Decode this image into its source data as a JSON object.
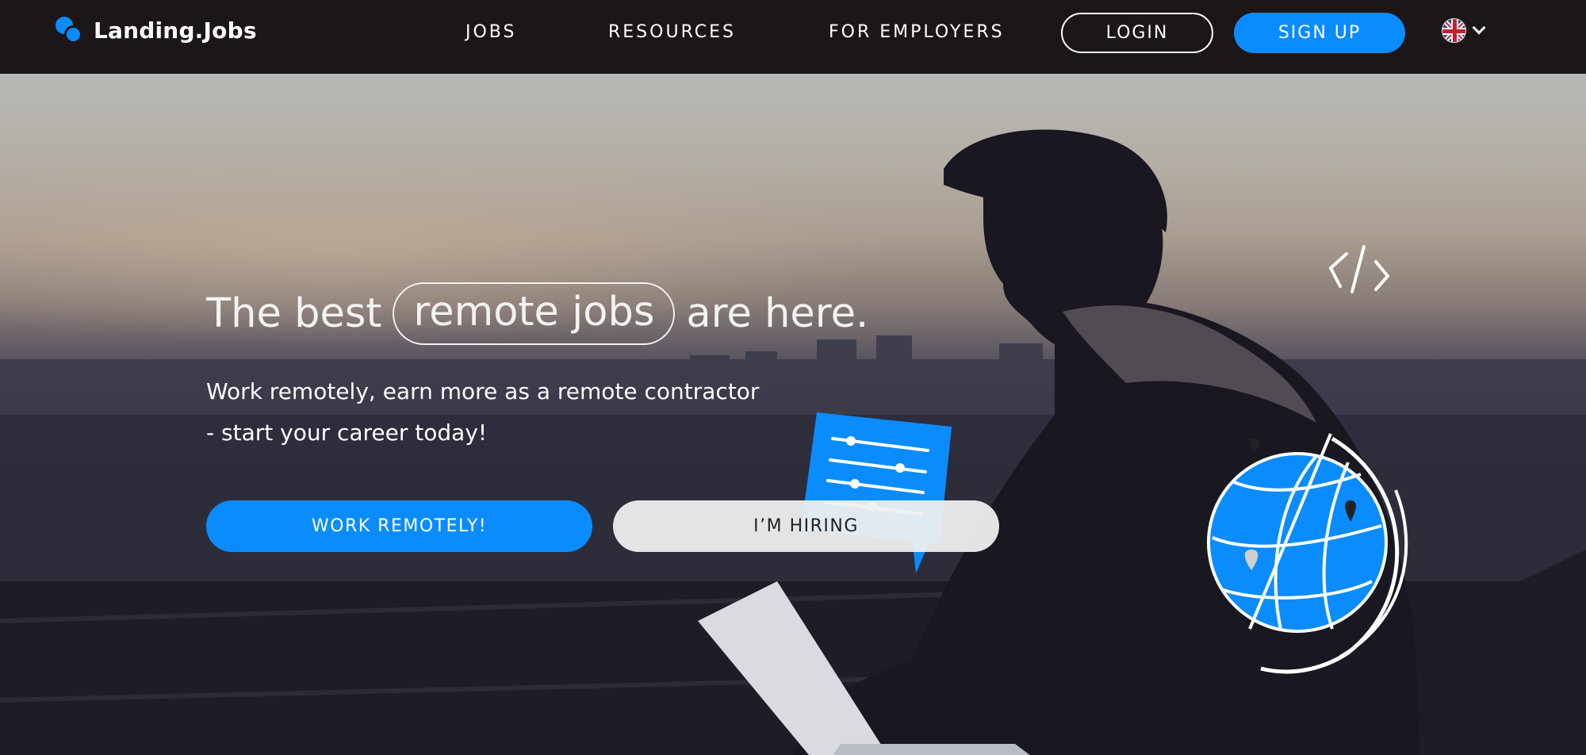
{
  "nav": {
    "logo_text": "Landing.Jobs",
    "links": [
      "JOBS",
      "RESOURCES",
      "FOR EMPLOYERS"
    ],
    "login_label": "LOGIN",
    "signup_label": "SIGN UP",
    "language_icon": "uk-flag-icon"
  },
  "hero": {
    "headline_before": "The best",
    "headline_highlight": "remote jobs",
    "headline_after": "are here.",
    "subtitle_line1": "Work remotely, earn more as a remote contractor",
    "subtitle_line2": "- start your career today!",
    "cta_primary": "WORK REMOTELY!",
    "cta_secondary": "I’M HIRING"
  },
  "colors": {
    "accent": "#0a8cff",
    "nav_bg": "#1d1618"
  }
}
